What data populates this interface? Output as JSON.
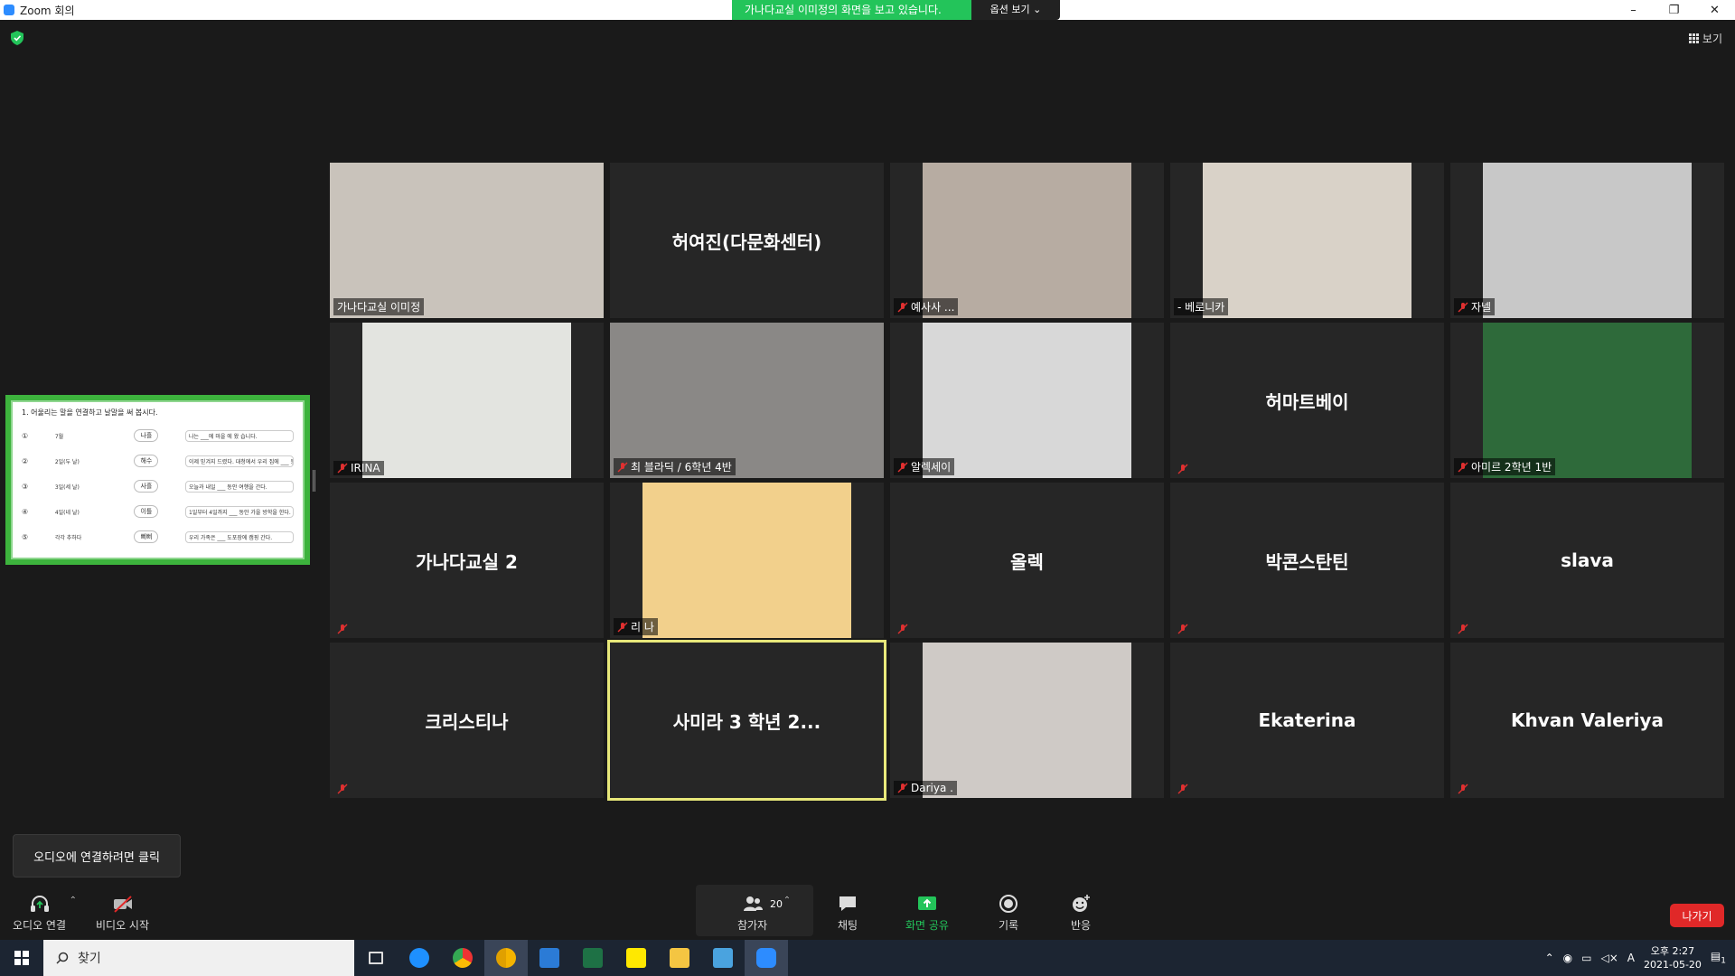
{
  "window": {
    "title": "Zoom 회의",
    "controls": [
      "–",
      "❐",
      "✕"
    ]
  },
  "banner": {
    "message": "가나다교실 이미정의 화면을 보고 있습니다.",
    "options": "옵션 보기 ⌄"
  },
  "view_button": "보기",
  "tiles": [
    {
      "name": "가나다교실 이미정",
      "type": "video",
      "muted": false,
      "bg": "#c9c3bb"
    },
    {
      "name": "허여진(다문화센터)",
      "type": "name",
      "muted": false
    },
    {
      "name": "예사사 ...",
      "type": "video",
      "muted": true,
      "bg": "#b7aca2"
    },
    {
      "name": "- 베로니카",
      "type": "video",
      "muted": false,
      "bg": "#d9d2c8"
    },
    {
      "name": "자넬",
      "type": "video",
      "muted": true,
      "bg": "#c8c8c8"
    },
    {
      "name": "IRINA",
      "type": "video",
      "muted": true,
      "bg": "#e3e4e0"
    },
    {
      "name": "최 블라딕 / 6학년 4반",
      "type": "video",
      "muted": true,
      "bg": "#8a8886"
    },
    {
      "name": "알렉세이",
      "type": "video",
      "muted": true,
      "bg": "#d8d8d8"
    },
    {
      "name": "허마트베이",
      "type": "name",
      "muted": true
    },
    {
      "name": "아미르 2학년 1반",
      "type": "video",
      "muted": true,
      "bg": "#2e6a3a"
    },
    {
      "name": "가나다교실 2",
      "type": "name",
      "muted": true
    },
    {
      "name": "리 나",
      "type": "video",
      "muted": true,
      "bg": "#f2d08c"
    },
    {
      "name": "올렉",
      "type": "name",
      "muted": true
    },
    {
      "name": "박콘스탄틴",
      "type": "name",
      "muted": true
    },
    {
      "name": "slava",
      "type": "name",
      "muted": true
    },
    {
      "name": "크리스티나",
      "type": "name",
      "muted": true
    },
    {
      "name": "사미라 3 학년 2...",
      "type": "name",
      "muted": false,
      "active": true
    },
    {
      "name": "Dariya .",
      "type": "video",
      "muted": true,
      "bg": "#cfcac6"
    },
    {
      "name": "Ekaterina",
      "type": "name",
      "muted": true
    },
    {
      "name": "Khvan Valeriya",
      "type": "name",
      "muted": true
    }
  ],
  "shared_screen": {
    "question": "1. 어울리는 말을 연결하고 날말을 써 봅시다.",
    "rows": [
      {
        "num": "①",
        "left": "7월",
        "mid": "나흘",
        "right": "나는 ___에 마을 에 왔 습니다."
      },
      {
        "num": "②",
        "left": "2일(두 날)",
        "mid": "해수",
        "right": "이제 믿겨지 드렸다. 대청에서 우리 집에 ___ 동안 계실 생각다."
      },
      {
        "num": "③",
        "left": "3일(세 날)",
        "mid": "사흘",
        "right": "오늘과 내일 ___ 동안 여행을 간다."
      },
      {
        "num": "④",
        "left": "4일(네 날)",
        "mid": "이틀",
        "right": "1일부터 4일까지 ___ 동안 가을 방학을 한다."
      },
      {
        "num": "⑤",
        "left": "각각 추하다",
        "mid": "뻐뻐",
        "right": "우리 가족은 ___ 도포장에 캠핑 간다."
      }
    ]
  },
  "tooltip": "오디오에 연결하려면 클릭",
  "toolbar": {
    "audio": "오디오 연결",
    "video": "비디오 시작",
    "participants": "참가자",
    "participants_count": "20",
    "chat": "채팅",
    "share": "화면 공유",
    "record": "기록",
    "reactions": "반응",
    "leave": "나가기"
  },
  "taskbar": {
    "search_placeholder": "찾기",
    "ime": "A",
    "time": "오후 2:27",
    "date": "2021-05-20",
    "notifications": "1"
  },
  "colors": {
    "accent_green": "#23c45a",
    "leave_red": "#e02828",
    "active_speaker": "#e8e87a"
  }
}
